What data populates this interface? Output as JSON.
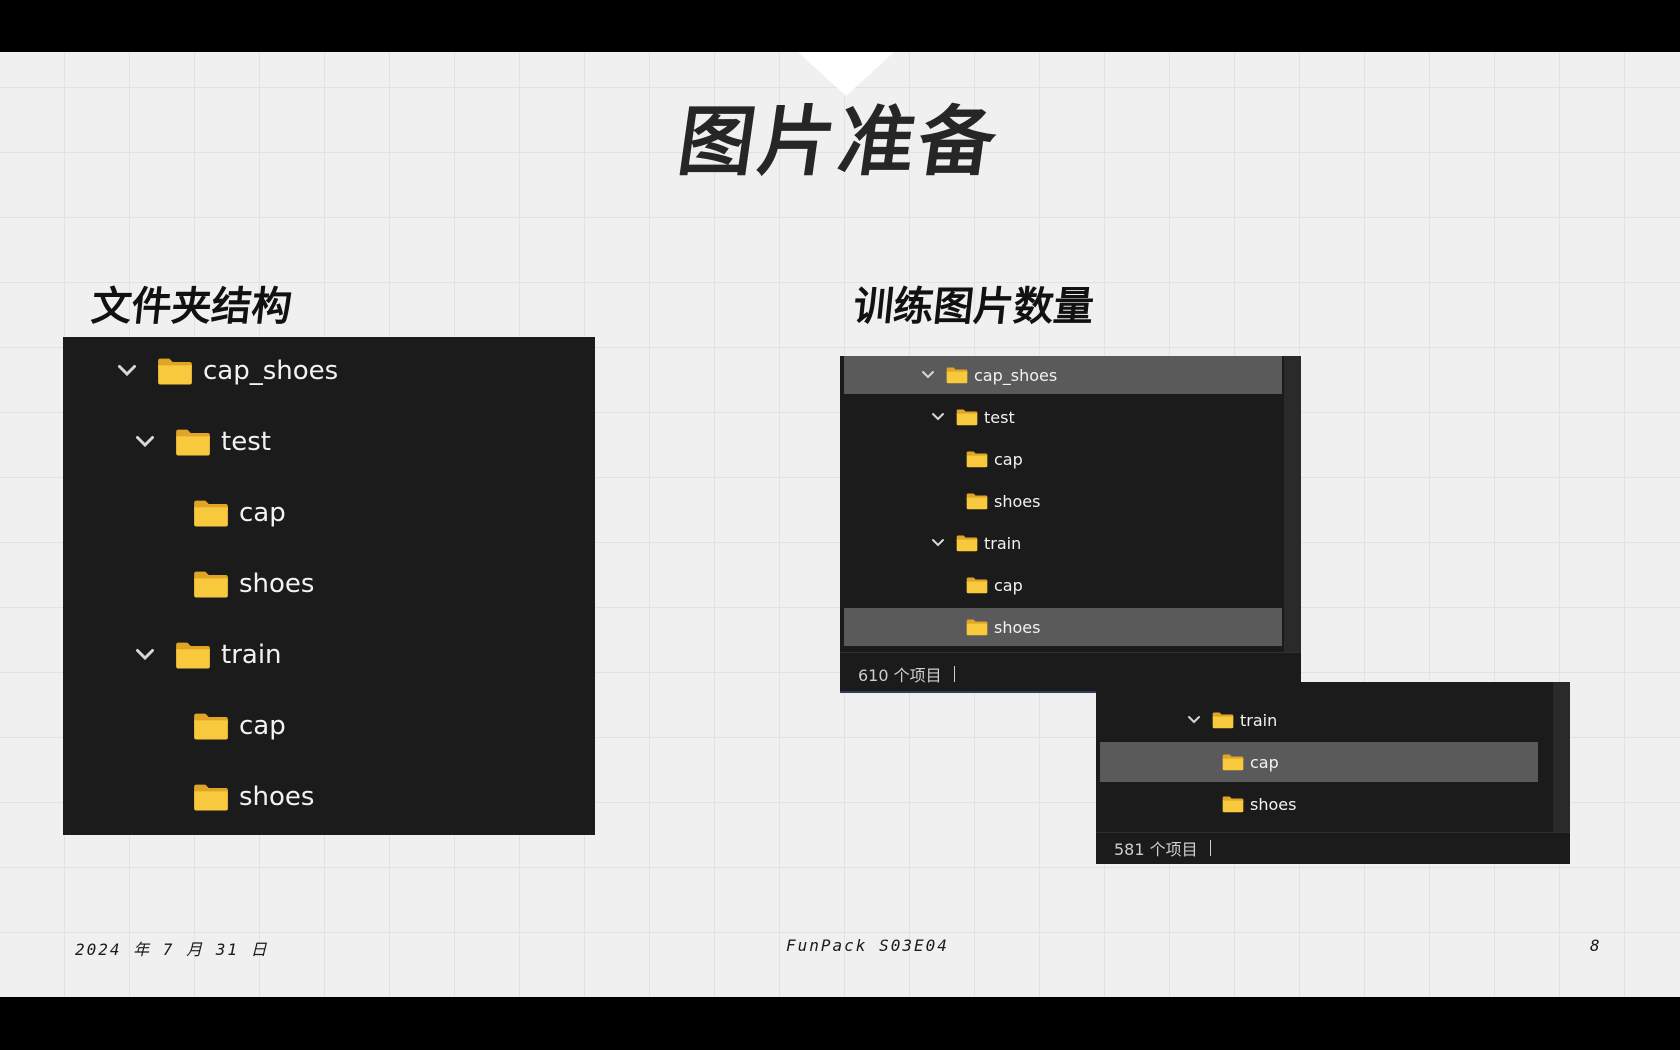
{
  "title": "图片准备",
  "left_section": {
    "label": "文件夹结构"
  },
  "right_section": {
    "label": "训练图片数量"
  },
  "left_tree": [
    {
      "name": "cap_shoes",
      "level": 0,
      "expanded": true
    },
    {
      "name": "test",
      "level": 1,
      "expanded": true
    },
    {
      "name": "cap",
      "level": 2
    },
    {
      "name": "shoes",
      "level": 2
    },
    {
      "name": "train",
      "level": 1,
      "expanded": true
    },
    {
      "name": "cap",
      "level": 2
    },
    {
      "name": "shoes",
      "level": 2
    }
  ],
  "explorer1": {
    "rows": [
      {
        "name": "cap_shoes",
        "level": 0,
        "expanded": true,
        "selected": true
      },
      {
        "name": "test",
        "level": 1,
        "expanded": true
      },
      {
        "name": "cap",
        "level": 2
      },
      {
        "name": "shoes",
        "level": 2
      },
      {
        "name": "train",
        "level": 1,
        "expanded": true
      },
      {
        "name": "cap",
        "level": 2
      },
      {
        "name": "shoes",
        "level": 2,
        "selected": true
      }
    ],
    "status": "610 个项目"
  },
  "explorer2": {
    "rows": [
      {
        "name": "train",
        "level": 1,
        "expanded": true
      },
      {
        "name": "cap",
        "level": 2,
        "selected": true
      },
      {
        "name": "shoes",
        "level": 2
      }
    ],
    "status": "581 个项目"
  },
  "footer": {
    "date": "2024 年 7 月 31 日",
    "event": "FunPack S03E04",
    "page_number": "8"
  },
  "colors": {
    "folder_yellow": "#f8c93c",
    "folder_back": "#e0a526",
    "panel_bg": "#1b1b1b",
    "selection": "#5a5a5a"
  }
}
